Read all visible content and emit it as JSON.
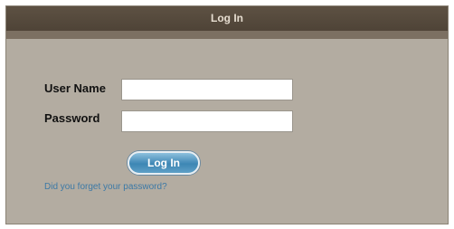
{
  "dialog": {
    "title": "Log In"
  },
  "form": {
    "username_label": "User Name",
    "username_value": "",
    "password_label": "Password",
    "password_value": "",
    "login_button": "Log In",
    "forgot_link": "Did you forget your password?"
  }
}
